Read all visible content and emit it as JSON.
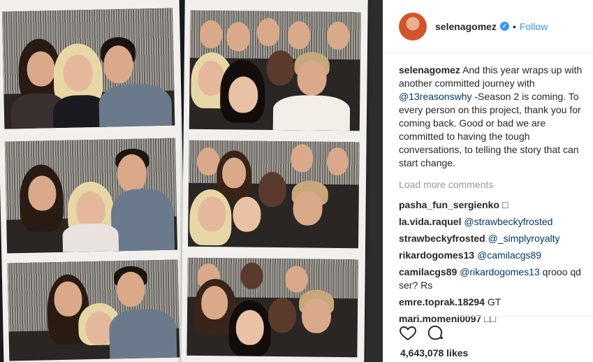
{
  "post": {
    "username": "selenagomez",
    "verified_icon": "verified-badge-icon",
    "separator": "•",
    "follow_label": "Follow",
    "caption": {
      "username": "selenagomez",
      "text_part1": "And this year wraps up with another committed journey with ",
      "mention": "@13reasonswhy",
      "text_part2": " -Season 2 is coming. To every person on this project, thank you for coming back. Good or bad we are committed to having the tough conversations, to telling the story that can start change."
    },
    "load_more_label": "Load more comments",
    "comments": [
      {
        "user": "pasha_fun_sergienko",
        "mention": "",
        "text": "□"
      },
      {
        "user": "la.vida.raquel",
        "mention": "@strawbeckyfrosted",
        "text": ""
      },
      {
        "user": "strawbeckyfrosted",
        "mention": "@_simplyroyalty",
        "text": ""
      },
      {
        "user": "rikardogomes13",
        "mention": "@camilacgs89",
        "text": ""
      },
      {
        "user": "camilacgs89",
        "mention": "@rikardogomes13",
        "text": " qrooo qd ser? Rs"
      },
      {
        "user": "emre.toprak.18294",
        "mention": "",
        "text": "GT"
      },
      {
        "user": "mari.momeni0097",
        "mention": "",
        "text": "□□"
      }
    ],
    "likes": "4,643,078 likes",
    "icons": {
      "like": "heart-icon",
      "comment": "comment-icon"
    }
  }
}
